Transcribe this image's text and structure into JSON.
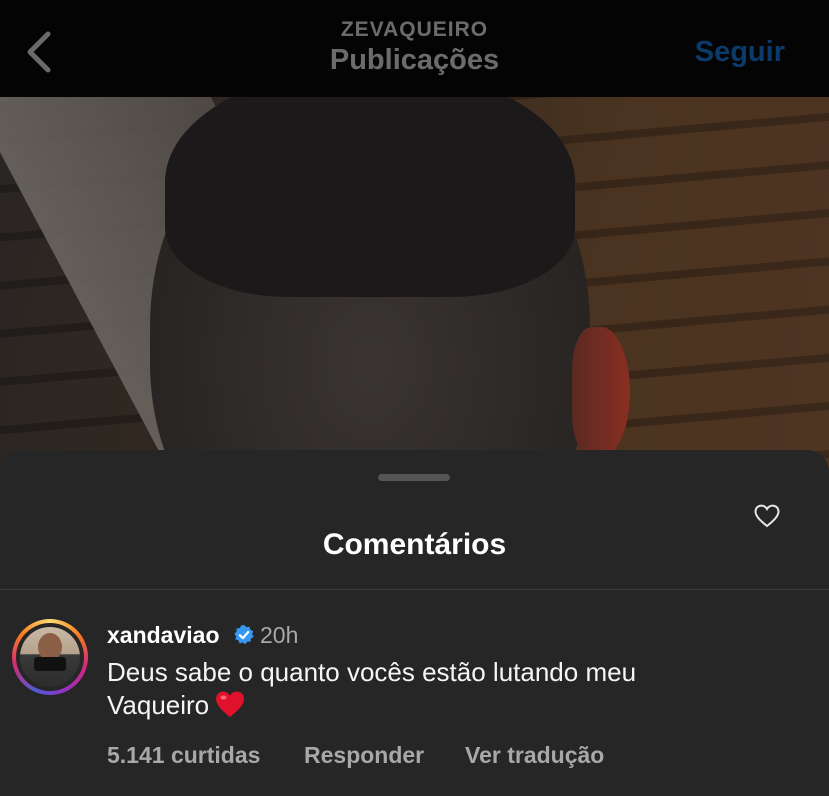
{
  "header": {
    "account_name": "ZEVAQUEIRO",
    "title": "Publicações",
    "follow_label": "Seguir",
    "follow_color": "#1d8cff"
  },
  "icons": {
    "back": "chevron-left-icon",
    "verified": "verified-badge-icon",
    "like": "heart-outline-icon",
    "emoji": "red-heart-emoji"
  },
  "sheet": {
    "title": "Comentários"
  },
  "comment": {
    "username": "xandaviao",
    "verified": true,
    "time": "20h",
    "text": "Deus sabe o quanto vocês estão lutando meu Vaqueiro",
    "likes": "5.141 curtidas",
    "reply_label": "Responder",
    "translate_label": "Ver tradução"
  }
}
